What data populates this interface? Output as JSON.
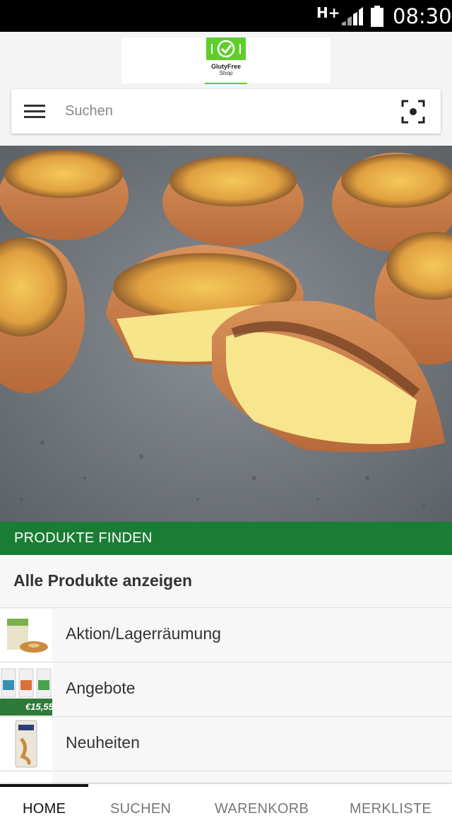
{
  "status_bar": {
    "network": "H+",
    "time": "08:30"
  },
  "header": {
    "logo_name": "GlutyFree",
    "logo_sub": "Shop"
  },
  "search": {
    "placeholder": "Suchen"
  },
  "icons": {
    "menu": "menu-icon",
    "scan": "scan-icon",
    "signal": "signal-icon",
    "battery": "battery-icon"
  },
  "colors": {
    "accent_green": "#1a7d35",
    "logo_green": "#5fce2c"
  },
  "section": {
    "title": "PRODUKTE FINDEN"
  },
  "all_products": {
    "label": "Alle Produkte anzeigen"
  },
  "categories": [
    {
      "label": "Aktion/Lagerräumung"
    },
    {
      "label": "Angebote",
      "thumb_badge": "€15,55"
    },
    {
      "label": "Neuheiten"
    }
  ],
  "bottom_nav": {
    "tabs": [
      {
        "label": "HOME",
        "active": true
      },
      {
        "label": "SUCHEN",
        "active": false
      },
      {
        "label": "WARENKORB",
        "active": false
      },
      {
        "label": "MERKLISTE",
        "active": false
      }
    ]
  }
}
